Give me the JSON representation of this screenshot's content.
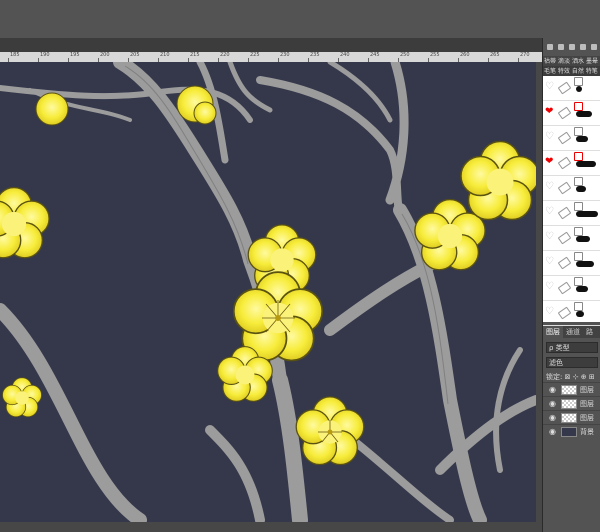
{
  "ruler": {
    "ticks": [
      "185",
      "190",
      "195",
      "200",
      "205",
      "210",
      "215",
      "220",
      "225",
      "230",
      "235",
      "240",
      "245",
      "250",
      "255",
      "260",
      "265",
      "270"
    ]
  },
  "brushes": {
    "tabs": [
      "祜蒂",
      "滴淡",
      "洒水",
      "墨晕"
    ],
    "subtitle": "毛笔 特效 自然 特笔",
    "rows": [
      {
        "heart": "♡",
        "mark": false
      },
      {
        "heart": "❤",
        "mark": true
      },
      {
        "heart": "♡",
        "mark": false
      },
      {
        "heart": "❤",
        "mark": true
      },
      {
        "heart": "♡",
        "mark": false
      },
      {
        "heart": "♡",
        "mark": false
      },
      {
        "heart": "♡",
        "mark": false
      },
      {
        "heart": "♡",
        "mark": false
      },
      {
        "heart": "♡",
        "mark": false
      },
      {
        "heart": "♡",
        "mark": false
      }
    ]
  },
  "layers_panel": {
    "tab_layers": "图层",
    "tab_channels": "通道",
    "tab_paths": "路",
    "filter_label": "ρ 类型",
    "blend_mode": "滤色",
    "lock_label": "锁定: ⊠ ⊹ ⊕ ⊞",
    "layers": [
      {
        "name": "图层",
        "eye": "👁"
      },
      {
        "name": "图层",
        "eye": "👁"
      },
      {
        "name": "图层",
        "eye": "👁"
      },
      {
        "name": "背景",
        "eye": "👁"
      }
    ]
  },
  "colors": {
    "canvas_bg": "#35384b",
    "blossom": "#f6ea3c",
    "branch": "#9a9a9a"
  }
}
